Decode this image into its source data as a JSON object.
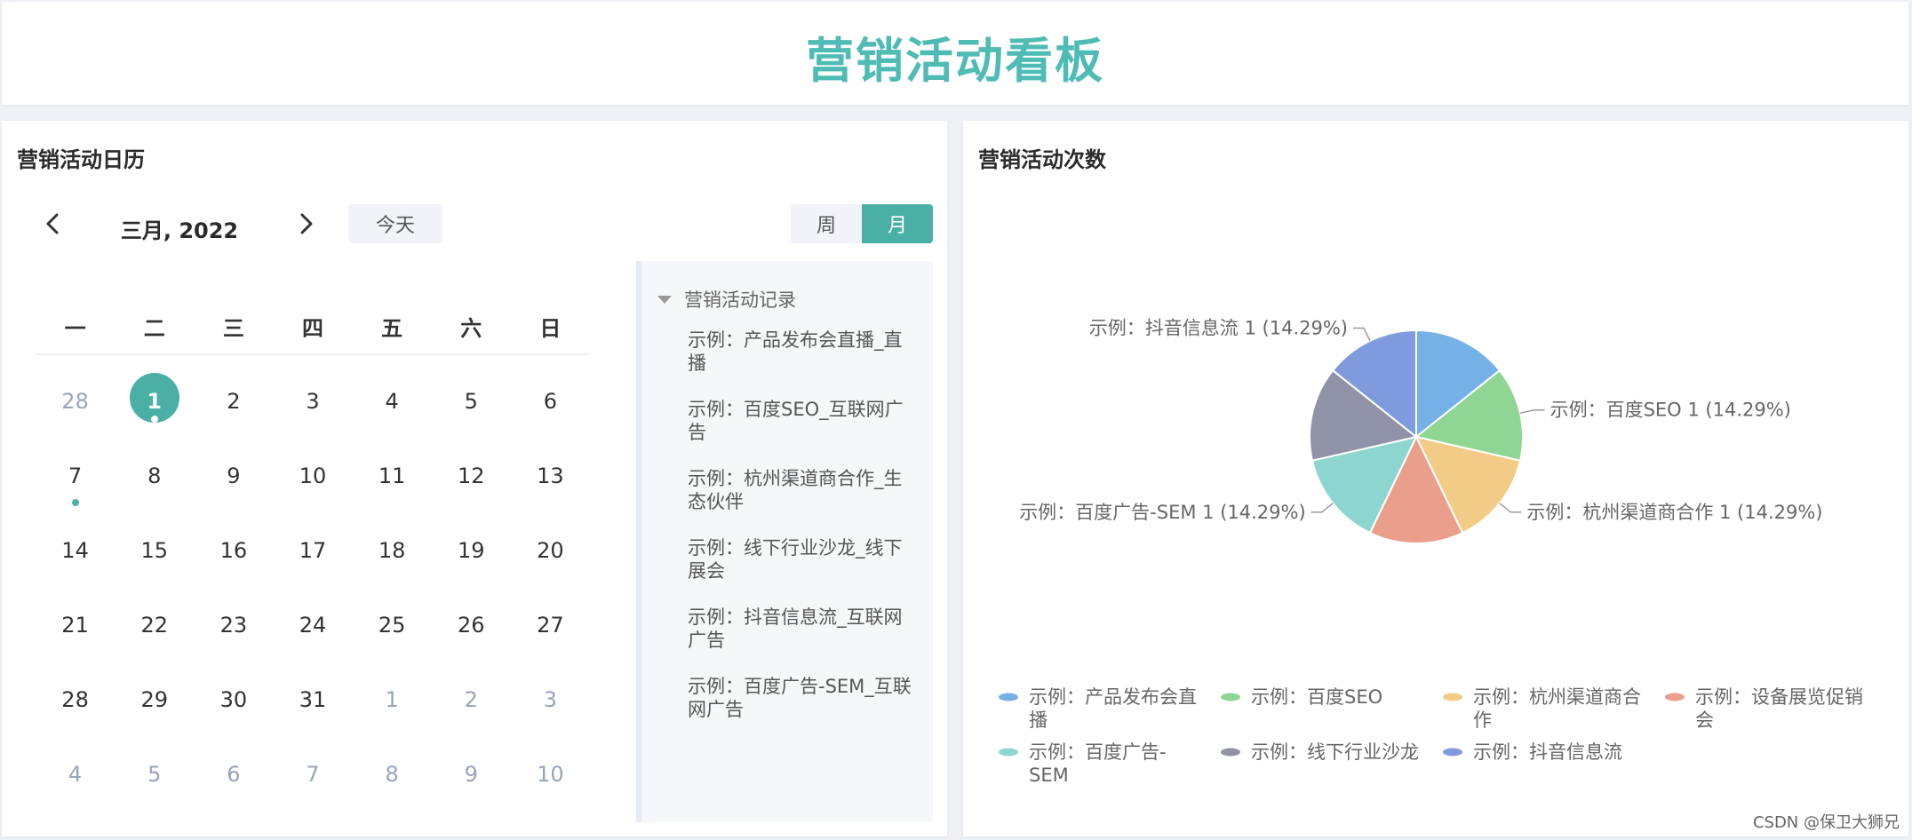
{
  "header": {
    "title": "营销活动看板"
  },
  "calendar_panel": {
    "title": "营销活动日历",
    "month_label": "三月, 2022",
    "today_label": "今天",
    "view_week_label": "周",
    "view_month_label": "月",
    "weekdays": [
      "一",
      "二",
      "三",
      "四",
      "五",
      "六",
      "日"
    ],
    "days": [
      {
        "d": "28",
        "other": true
      },
      {
        "d": "1",
        "today": true,
        "dot": true
      },
      {
        "d": "2"
      },
      {
        "d": "3"
      },
      {
        "d": "4"
      },
      {
        "d": "5"
      },
      {
        "d": "6"
      },
      {
        "d": "7",
        "dot": true
      },
      {
        "d": "8"
      },
      {
        "d": "9"
      },
      {
        "d": "10"
      },
      {
        "d": "11"
      },
      {
        "d": "12"
      },
      {
        "d": "13"
      },
      {
        "d": "14"
      },
      {
        "d": "15"
      },
      {
        "d": "16"
      },
      {
        "d": "17"
      },
      {
        "d": "18"
      },
      {
        "d": "19"
      },
      {
        "d": "20"
      },
      {
        "d": "21"
      },
      {
        "d": "22"
      },
      {
        "d": "23"
      },
      {
        "d": "24"
      },
      {
        "d": "25"
      },
      {
        "d": "26"
      },
      {
        "d": "27"
      },
      {
        "d": "28"
      },
      {
        "d": "29"
      },
      {
        "d": "30"
      },
      {
        "d": "31"
      },
      {
        "d": "1",
        "other": true
      },
      {
        "d": "2",
        "other": true
      },
      {
        "d": "3",
        "other": true
      },
      {
        "d": "4",
        "other": true
      },
      {
        "d": "5",
        "other": true
      },
      {
        "d": "6",
        "other": true
      },
      {
        "d": "7",
        "other": true
      },
      {
        "d": "8",
        "other": true
      },
      {
        "d": "9",
        "other": true
      },
      {
        "d": "10",
        "other": true
      }
    ],
    "records_title": "营销活动记录",
    "records": [
      "示例：产品发布会直播_直播",
      "示例：百度SEO_互联网广告",
      "示例：杭州渠道商合作_生态伙伴",
      "示例：线下行业沙龙_线下展会",
      "示例：抖音信息流_互联网广告",
      "示例：百度广告-SEM_互联网广告"
    ]
  },
  "chart_panel": {
    "title": "营销活动次数"
  },
  "chart_data": {
    "type": "pie",
    "slices": [
      {
        "name": "示例：产品发布会直播",
        "value": 1,
        "color": "#75b0e6"
      },
      {
        "name": "示例：百度SEO",
        "value": 1,
        "color": "#8fd694"
      },
      {
        "name": "示例：杭州渠道商合作",
        "value": 1,
        "color": "#f2cc87"
      },
      {
        "name": "示例：设备展览促销会",
        "value": 1,
        "color": "#ea9e8c"
      },
      {
        "name": "示例：百度广告-SEM",
        "value": 1,
        "color": "#8cd6cf"
      },
      {
        "name": "示例：线下行业沙龙",
        "value": 1,
        "color": "#9093a8"
      },
      {
        "name": "示例：抖音信息流",
        "value": 1,
        "color": "#7f9bde"
      }
    ],
    "labels": [
      {
        "slice": 6,
        "text": "示例：抖音信息流 1 (14.29%)"
      },
      {
        "slice": 1,
        "text": "示例：百度SEO 1 (14.29%)"
      },
      {
        "slice": 2,
        "text": "示例：杭州渠道商合作 1 (14.29%)"
      },
      {
        "slice": 4,
        "text": "示例：百度广告-SEM 1 (14.29%)"
      }
    ],
    "legend": [
      "示例：产品发布会直播",
      "示例：百度SEO",
      "示例：杭州渠道商合作",
      "示例：设备展览促销会",
      "示例：百度广告-SEM",
      "示例：线下行业沙龙",
      "示例：抖音信息流"
    ]
  },
  "watermark": "CSDN @保卫大狮兄"
}
